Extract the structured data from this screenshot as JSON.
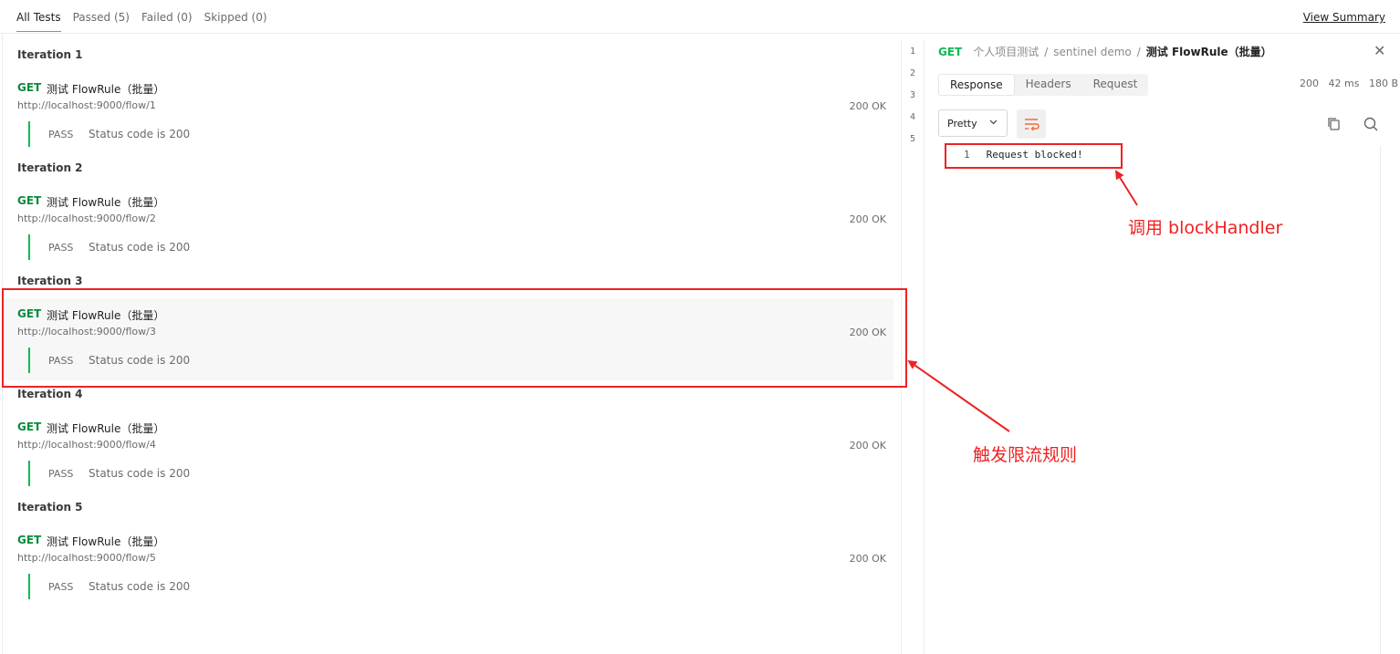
{
  "tabs": [
    "All Tests",
    "Passed (5)",
    "Failed (0)",
    "Skipped (0)"
  ],
  "view_summary": "View Summary",
  "iterations": [
    {
      "title": "Iteration 1",
      "method": "GET",
      "name": "测试 FlowRule（批量）",
      "url": "http://localhost:9000/flow/1",
      "status": "200 OK",
      "result": "PASS",
      "test": "Status code is 200",
      "highlighted": false
    },
    {
      "title": "Iteration 2",
      "method": "GET",
      "name": "测试 FlowRule（批量）",
      "url": "http://localhost:9000/flow/2",
      "status": "200 OK",
      "result": "PASS",
      "test": "Status code is 200",
      "highlighted": false
    },
    {
      "title": "Iteration 3",
      "method": "GET",
      "name": "测试 FlowRule（批量）",
      "url": "http://localhost:9000/flow/3",
      "status": "200 OK",
      "result": "PASS",
      "test": "Status code is 200",
      "highlighted": true
    },
    {
      "title": "Iteration 4",
      "method": "GET",
      "name": "测试 FlowRule（批量）",
      "url": "http://localhost:9000/flow/4",
      "status": "200 OK",
      "result": "PASS",
      "test": "Status code is 200",
      "highlighted": false
    },
    {
      "title": "Iteration 5",
      "method": "GET",
      "name": "测试 FlowRule（批量）",
      "url": "http://localhost:9000/flow/5",
      "status": "200 OK",
      "result": "PASS",
      "test": "Status code is 200",
      "highlighted": false
    }
  ],
  "gutter": [
    "1",
    "2",
    "3",
    "4",
    "5"
  ],
  "response": {
    "method": "GET",
    "breadcrumb": [
      "个人项目测试",
      "sentinel demo",
      "测试 FlowRule（批量）"
    ],
    "tabs": [
      "Response",
      "Headers",
      "Request"
    ],
    "status": "200",
    "time": "42 ms",
    "size": "180 B",
    "format": "Pretty",
    "line_number": "1",
    "body": "Request blocked!"
  },
  "annotations": {
    "block_handler": "调用 blockHandler",
    "flow_rule": "触发限流规则"
  },
  "colors": {
    "accent": "#f26b3a",
    "method_get": "#0b8a3e",
    "pass_bar": "#0cbb52",
    "annotation": "#ee2222"
  }
}
